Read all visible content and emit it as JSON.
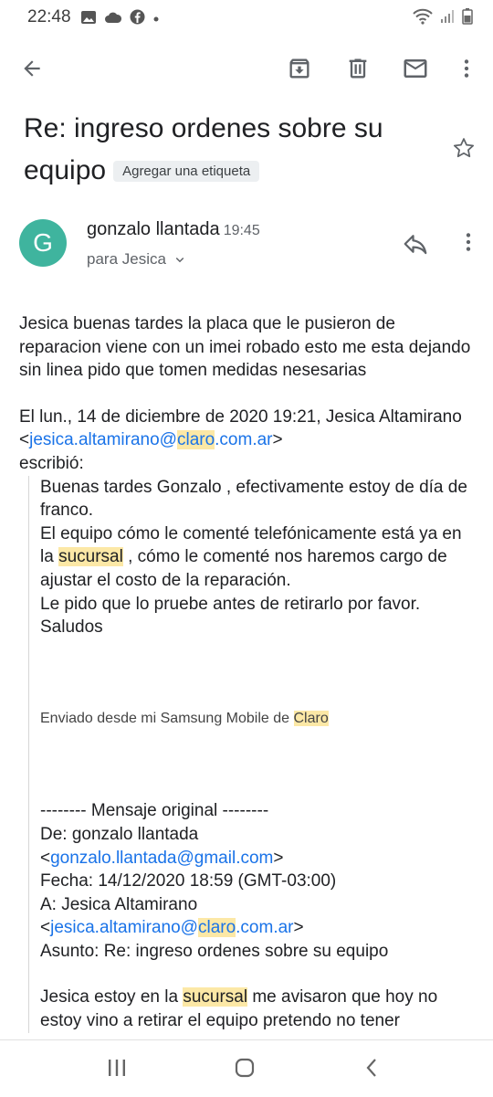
{
  "status_bar": {
    "time": "22:48"
  },
  "toolbar": {},
  "email": {
    "subject": "Re: ingreso ordenes sobre su equipo",
    "label_chip": "Agregar una etiqueta",
    "avatar_letter": "G",
    "sender": "gonzalo llantada",
    "time": "19:45",
    "recipient": "para Jesica"
  },
  "body": {
    "p1": "Jesica buenas tardes la placa que le pusieron de reparacion viene con un imei robado esto me esta dejando sin linea pido que tomen medidas nesesarias",
    "on_prefix": "El lun., 14 de diciembre de 2020 19:21, Jesica Altamirano <",
    "email1_a": "jesica.altamirano@",
    "email1_b": "claro",
    "email1_c": ".com.ar",
    "on_suffix": ">",
    "wrote": "escribió:",
    "q_line1": "Buenas tardes Gonzalo , efectivamente estoy de día de franco.",
    "q_line2a": "El equipo cómo le comenté telefónicamente está ya en la ",
    "q_line2_hl": "sucursal",
    "q_line2b": " , cómo le comenté nos haremos cargo de ajustar el costo de la reparación.",
    "q_line3": "Le pido que lo pruebe antes de retirarlo por favor.",
    "q_line4": "Saludos",
    "sent_from_a": "Enviado desde mi Samsung Mobile de ",
    "sent_from_hl": "Claro",
    "orig_header": "-------- Mensaje original --------",
    "from_line": "De: gonzalo llantada",
    "from_lt": "<",
    "from_email": "gonzalo.llantada@gmail.com",
    "from_gt": ">",
    "date_line": "Fecha: 14/12/2020 18:59 (GMT-03:00)",
    "to_line": "A: Jesica Altamirano",
    "to_lt": "<",
    "to_email_a": "jesica.altamirano@",
    "to_email_b": "claro",
    "to_email_c": ".com.ar",
    "to_gt": ">",
    "subject_line": "Asunto: Re: ingreso ordenes sobre su equipo",
    "last_a": "Jesica estoy en la ",
    "last_hl": "sucursal",
    "last_b": " me avisaron que hoy no estoy vino a retirar el equipo pretendo no tener"
  },
  "colors": {
    "avatar": "#3fb49e",
    "link": "#1a73e8",
    "highlight": "#fce8a6"
  }
}
